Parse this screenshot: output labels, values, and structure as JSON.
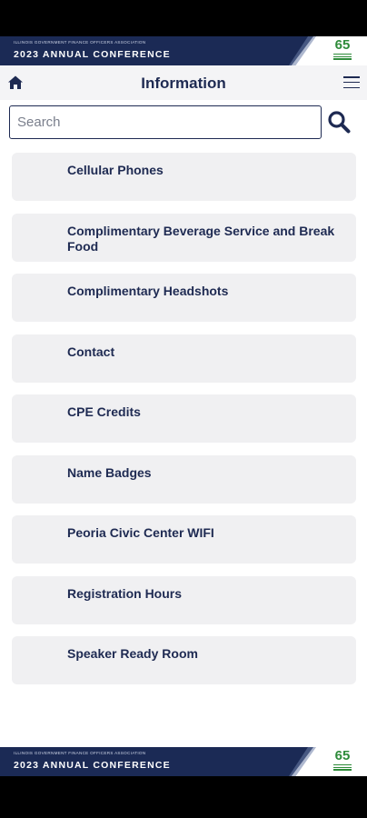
{
  "banner": {
    "association": "ILLINOIS GOVERNMENT FINANCE OFFICERS ASSOCIATION",
    "title": "2023 ANNUAL CONFERENCE",
    "logo_number": "65",
    "brand_color": "#1b2a55",
    "logo_color": "#2e8b3a"
  },
  "header": {
    "title": "Information",
    "home_icon": "home-icon",
    "menu_icon": "hamburger-menu-icon"
  },
  "search": {
    "placeholder": "Search",
    "value": "",
    "icon": "search-icon"
  },
  "items": [
    {
      "label": "Cellular Phones"
    },
    {
      "label": "Complimentary Beverage Service and Break Food"
    },
    {
      "label": "Complimentary Headshots"
    },
    {
      "label": "Contact"
    },
    {
      "label": "CPE Credits"
    },
    {
      "label": "Name Badges"
    },
    {
      "label": "Peoria Civic Center WIFI"
    },
    {
      "label": "Registration Hours"
    },
    {
      "label": "Speaker Ready Room"
    }
  ]
}
